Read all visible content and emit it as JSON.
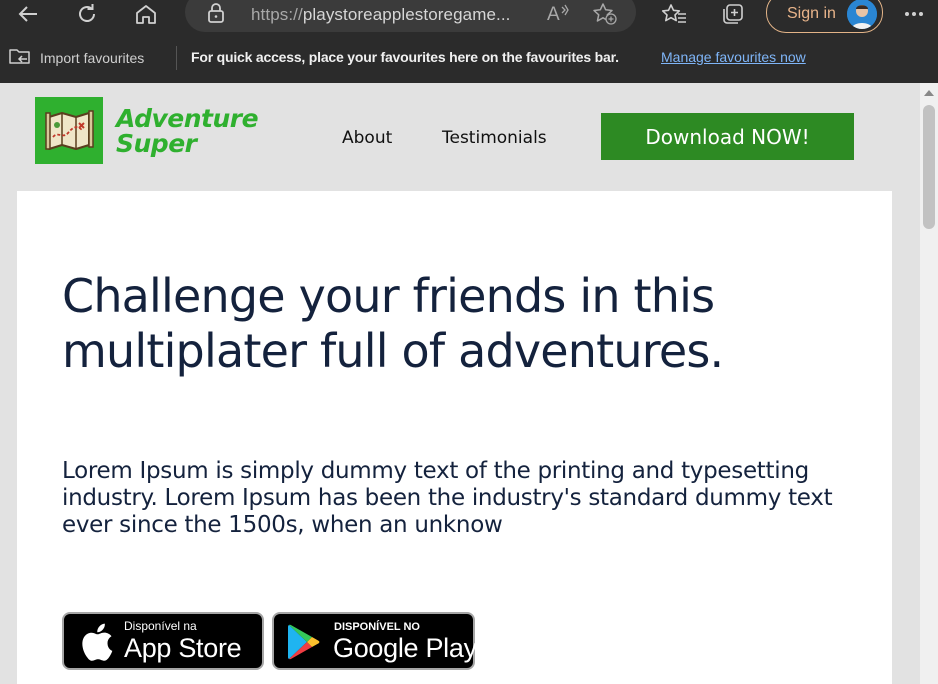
{
  "browser": {
    "url_prefix": "https://",
    "url_host": "playstoreapplestoregame...",
    "sign_in_label": "Sign in"
  },
  "favourites_bar": {
    "import_label": "Import favourites",
    "message": "For quick access, place your favourites here on the favourites bar.",
    "manage_link": "Manage favourites now"
  },
  "site": {
    "logo_line1": "Adventure",
    "logo_line2": "Super",
    "nav": {
      "about": "About",
      "testimonials": "Testimonials"
    },
    "cta_label": "Download NOW!",
    "brand_color": "#2fb02f",
    "cta_color": "#2d8a23",
    "text_color": "#14223d"
  },
  "hero": {
    "title": "Challenge your friends in this multiplater full of adventures.",
    "body": "Lorem Ipsum is simply dummy text of the printing and typesetting industry. Lorem Ipsum has been the industry's standard dummy text ever since the 1500s, when an unknow"
  },
  "badges": {
    "apple_small": "Disponível na",
    "apple_big": "App Store",
    "google_small": "DISPONÍVEL NO",
    "google_big": "Google Play"
  },
  "icons": [
    "back-icon",
    "refresh-icon",
    "home-icon",
    "lock-icon",
    "read-aloud-icon",
    "add-favourite-icon",
    "favourites-icon",
    "collections-icon",
    "more-icon",
    "import-favourites-icon",
    "map-logo-icon",
    "apple-icon",
    "google-play-icon"
  ]
}
